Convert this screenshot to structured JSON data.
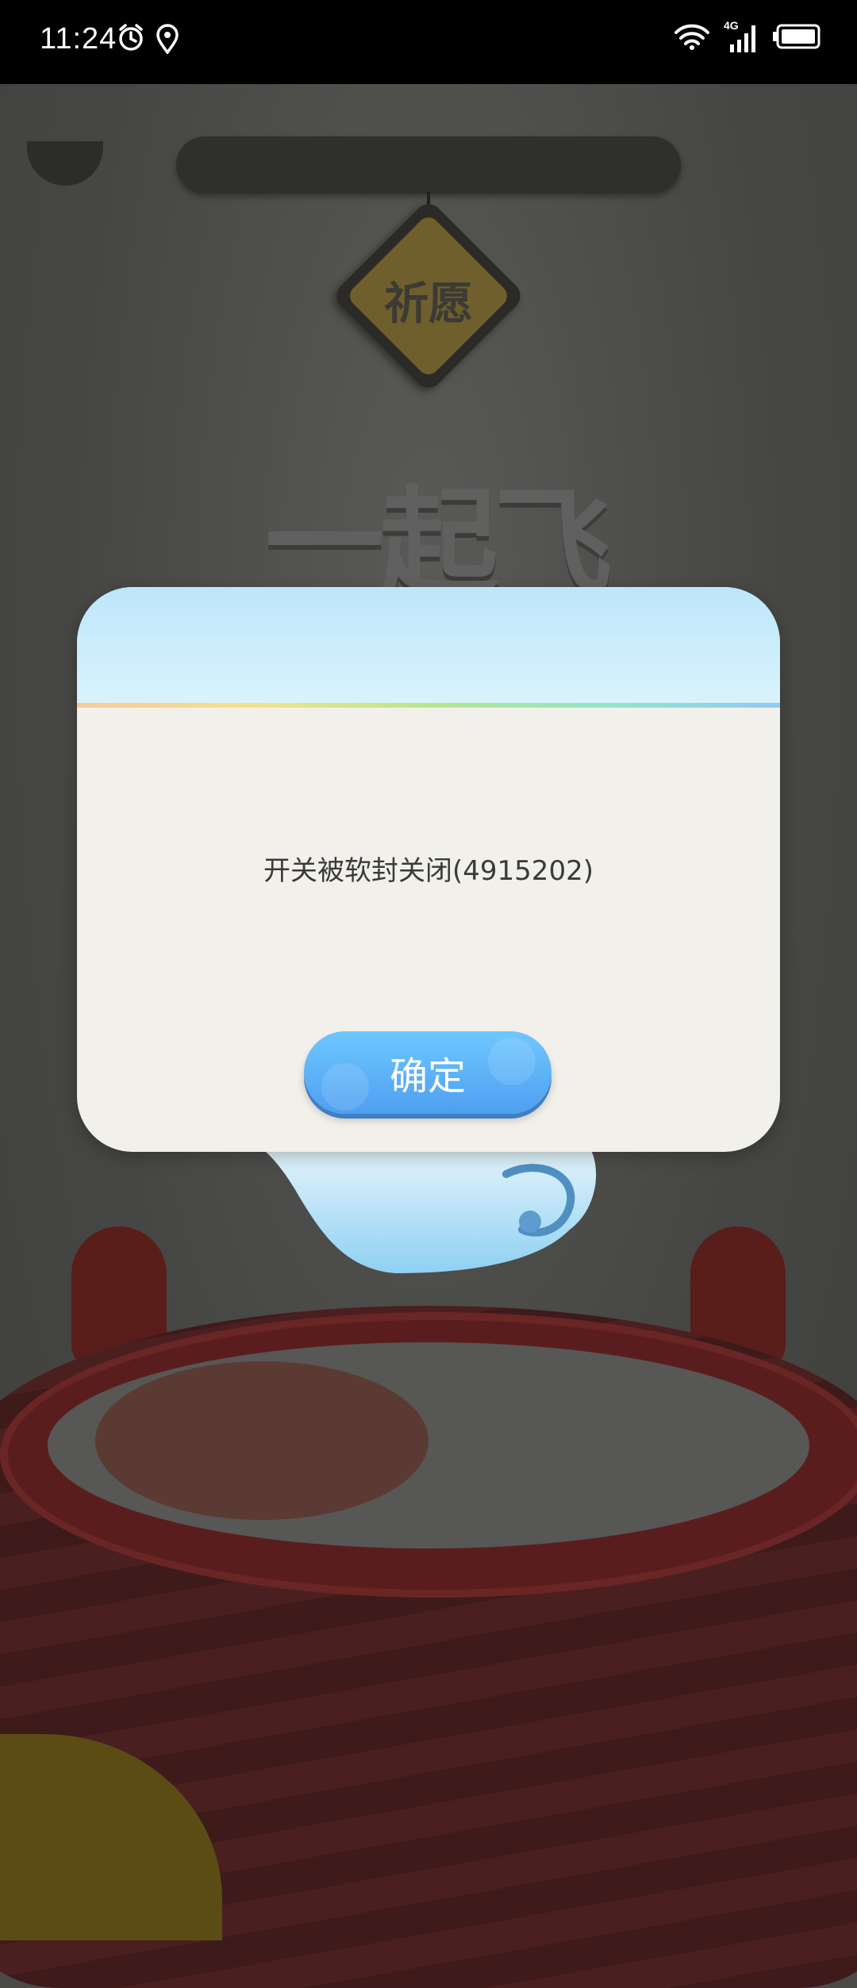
{
  "status_bar": {
    "time": "11:24",
    "icons": [
      "alarm-icon",
      "location-icon",
      "wifi-icon",
      "4g-signal-icon",
      "battery-icon"
    ],
    "network": "4G"
  },
  "background": {
    "wish_tag": "祈愿",
    "title_art": "一起飞"
  },
  "dialog": {
    "message": "开关被软封关闭(4915202)",
    "confirm_label": "确定"
  }
}
